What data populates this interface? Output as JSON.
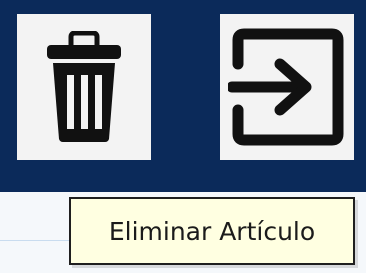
{
  "toolbar": {
    "buttons": [
      {
        "icon": "trash-icon",
        "label": ""
      },
      {
        "icon": "exit-arrow-icon",
        "label": ""
      }
    ]
  },
  "tooltip": {
    "text": "Eliminar Artículo"
  },
  "colors": {
    "toolbar_background": "#0b2a5a",
    "button_background": "#f3f3f3",
    "tooltip_background": "#ffffe1",
    "icon_color": "#111111"
  }
}
